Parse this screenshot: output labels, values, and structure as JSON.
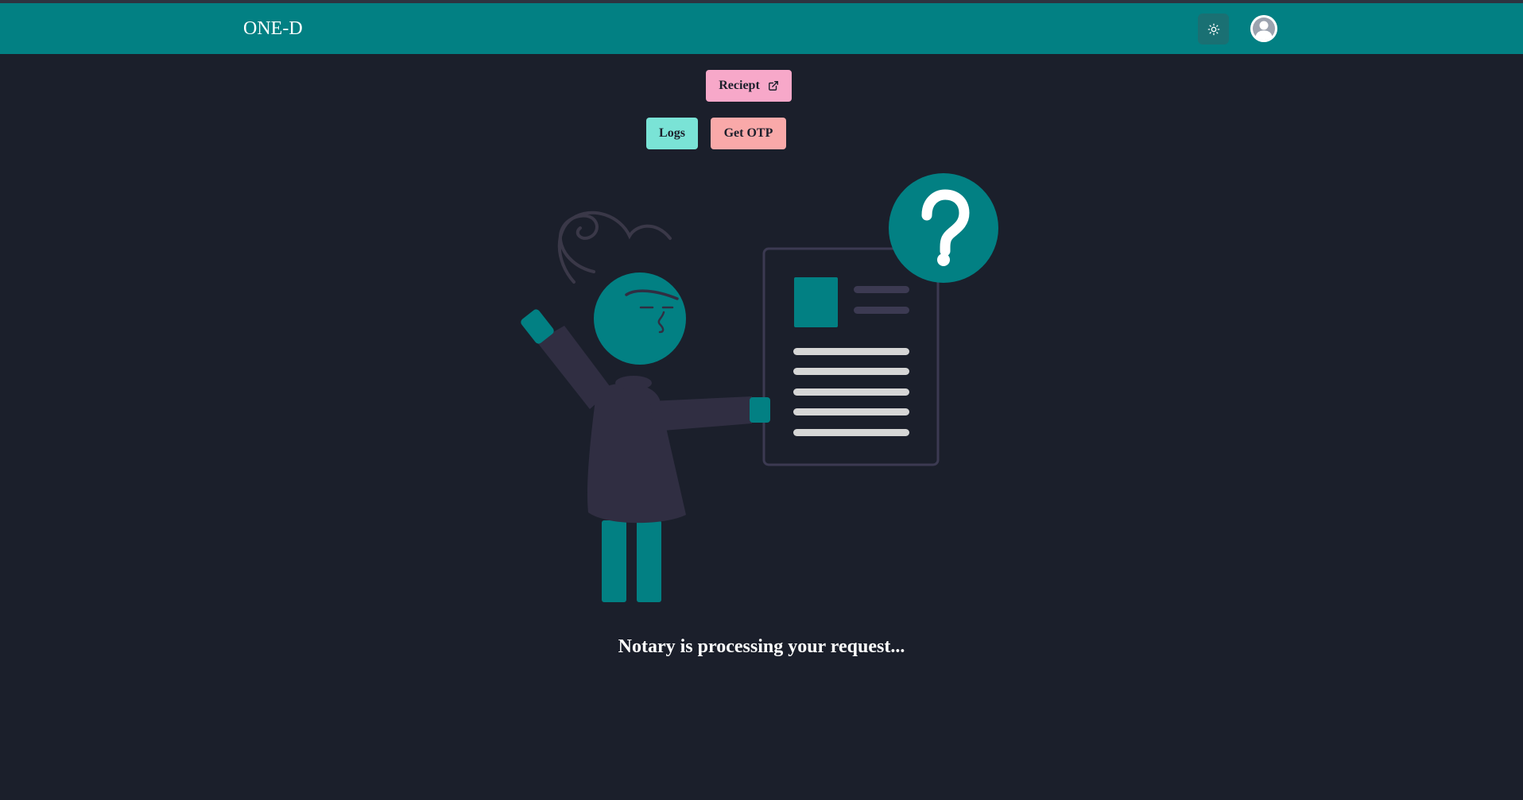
{
  "navbar": {
    "brand": "ONE-D",
    "theme_toggle_icon": "sun-icon",
    "avatar_icon": "user-avatar-icon"
  },
  "actions": {
    "receipt_label": "Reciept",
    "receipt_icon": "external-link-icon",
    "logs_label": "Logs",
    "otp_label": "Get OTP"
  },
  "status": {
    "message": "Notary is processing your request..."
  },
  "colors": {
    "navbar": "#028083",
    "background": "#1b1f2b",
    "accent_teal": "#028083",
    "receipt_button": "#f7a8c9",
    "logs_button": "#7ae3d6",
    "otp_button": "#f9a9a9"
  }
}
